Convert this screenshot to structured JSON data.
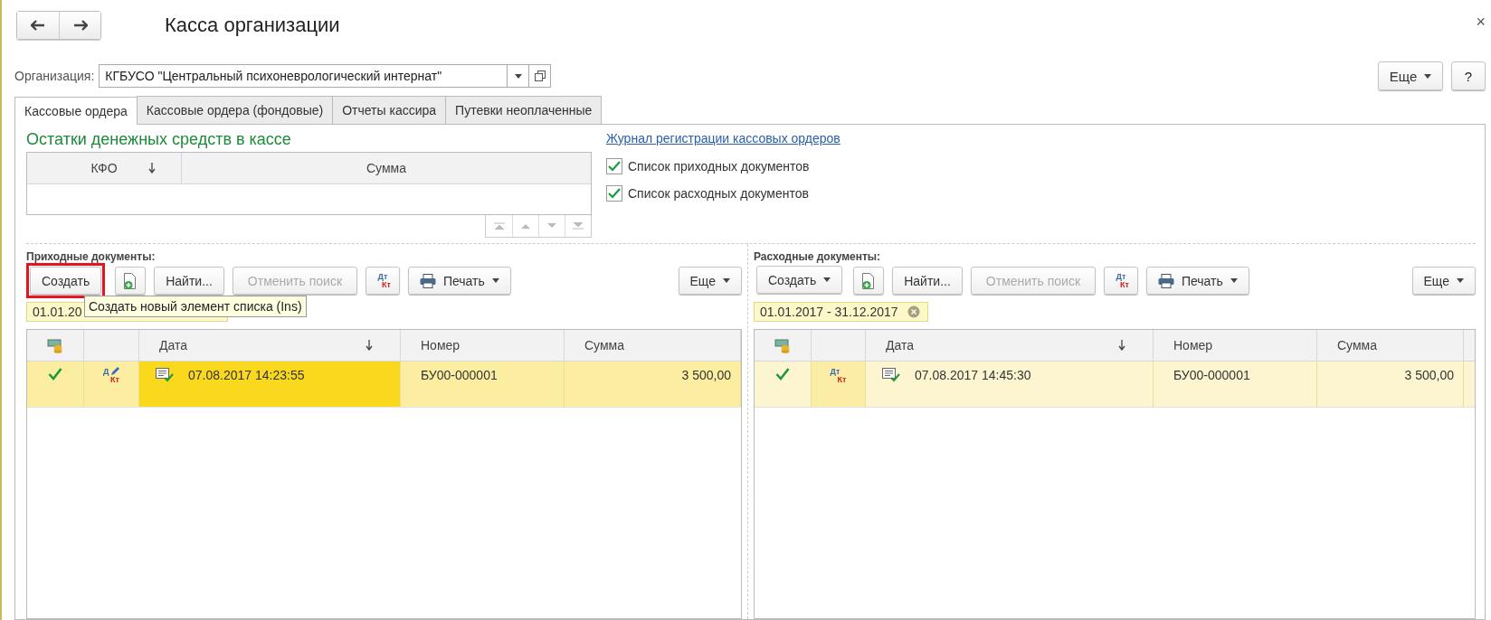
{
  "window": {
    "title": "Касса организации",
    "close": "×"
  },
  "organization": {
    "label": "Организация:",
    "value": "КГБУСО \"Центральный психоневрологический интернат\""
  },
  "header_buttons": [
    {
      "kind": "more",
      "label": "Еще"
    },
    {
      "kind": "help",
      "label": "?"
    }
  ],
  "tabs": [
    {
      "label": "Кассовые ордера",
      "selected": true
    },
    {
      "label": "Кассовые ордера (фондовые)",
      "selected": false
    },
    {
      "label": "Отчеты кассира",
      "selected": false
    },
    {
      "label": "Путевки неоплаченные",
      "selected": false
    }
  ],
  "balance": {
    "title": "Остатки денежных средств в кассе",
    "columns": [
      {
        "label": "КФО",
        "sorted": true
      },
      {
        "label": "Сумма",
        "sorted": false
      }
    ]
  },
  "journal_link": "Журнал регистрации кассовых ордеров",
  "options": [
    {
      "label": "Список приходных документов",
      "checked": true
    },
    {
      "label": "Список расходных документов",
      "checked": true
    }
  ],
  "lists": [
    {
      "title": "Приходные документы:",
      "focused": true,
      "toolbar": [
        {
          "kind": "create",
          "label": "Создать",
          "dropdown": false,
          "highlighted": true
        },
        {
          "kind": "copy"
        },
        {
          "kind": "text",
          "label": "Найти...",
          "disabled": false
        },
        {
          "kind": "text",
          "label": "Отменить поиск",
          "disabled": true
        },
        {
          "kind": "dtkt",
          "top": "Дт",
          "bottom": "Кт"
        },
        {
          "kind": "print",
          "label": "Печать",
          "dropdown": true
        },
        {
          "kind": "more",
          "label": "Еще",
          "dropdown": true
        }
      ],
      "filter": "01.01.20",
      "filter_clear": false,
      "tooltip": "Создать новый элемент списка (Ins)",
      "columns": [
        {
          "label": "Дата",
          "sorted": true
        },
        {
          "label": "Номер",
          "sorted": false
        },
        {
          "label": "Сумма",
          "sorted": false
        }
      ],
      "rows": [
        {
          "posted": true,
          "entry_icon": {
            "top": "Д",
            "bottom": "Кт",
            "pencil": true
          },
          "date": "07.08.2017 14:23:55",
          "number": "БУ00-000001",
          "sum": "3 500,00",
          "selected": true
        }
      ]
    },
    {
      "title": "Расходные документы:",
      "focused": false,
      "toolbar": [
        {
          "kind": "create",
          "label": "Создать",
          "dropdown": true,
          "highlighted": false
        },
        {
          "kind": "copy"
        },
        {
          "kind": "text",
          "label": "Найти...",
          "disabled": false
        },
        {
          "kind": "text",
          "label": "Отменить поиск",
          "disabled": true
        },
        {
          "kind": "dtkt",
          "top": "Дт",
          "bottom": "Кт"
        },
        {
          "kind": "print",
          "label": "Печать",
          "dropdown": true
        },
        {
          "kind": "more",
          "label": "Еще",
          "dropdown": true
        }
      ],
      "filter": "01.01.2017 - 31.12.2017",
      "filter_clear": true,
      "columns": [
        {
          "label": "Дата",
          "sorted": true
        },
        {
          "label": "Номер",
          "sorted": false
        },
        {
          "label": "Сумма",
          "sorted": false
        }
      ],
      "rows": [
        {
          "posted": true,
          "entry_icon": {
            "top": "Дт",
            "bottom": "Кт",
            "pencil": false
          },
          "date": "07.08.2017 14:45:30",
          "number": "БУ00-000001",
          "sum": "3 500,00",
          "selected": true
        }
      ]
    }
  ]
}
